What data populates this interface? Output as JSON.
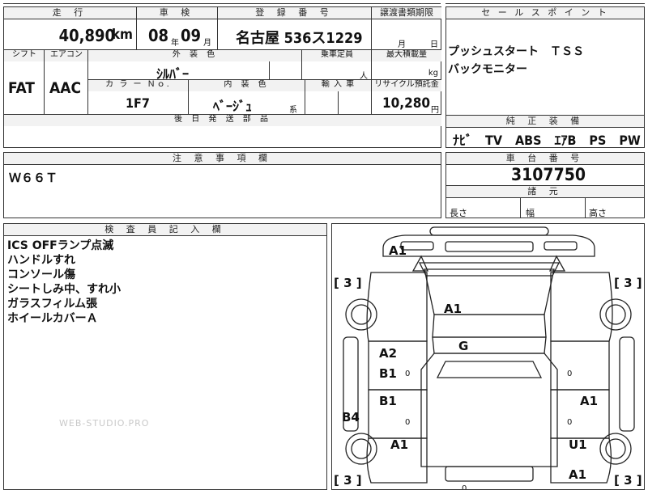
{
  "top_main": {
    "headers": {
      "mileage": "走 行",
      "inspection": "車 検",
      "registration": "登 録 番 号",
      "transfer_deadline": "譲渡書類期限"
    },
    "mileage_value": "40,890",
    "mileage_unit": "km",
    "inspection_year": "08",
    "inspection_year_unit": "年",
    "inspection_month": "09",
    "inspection_month_unit": "月",
    "registration_value": "名古屋 536ス1229",
    "transfer_month_unit": "月",
    "transfer_day_unit": "日",
    "shift_header": "シフト",
    "aircon_header": "エアコン",
    "exterior_color_header": "外 装 色",
    "capacity_header": "乗車定員",
    "max_load_header": "最大積載量",
    "shift_value": "FAT",
    "aircon_value": "AAC",
    "exterior_color_value": "ｼﾙﾊﾞｰ",
    "capacity_unit": "人",
    "max_load_unit": "kg",
    "color_no_header": "カ ラ ー Ｎｏ.",
    "interior_color_header": "内 装 色",
    "import_header": "輸 入 車",
    "recycle_header": "リサイクル預託金",
    "color_no_value": "1F7",
    "interior_color_value": "ﾍﾞｰｼﾞｭ",
    "interior_color_suffix": "系",
    "recycle_value": "10,280",
    "recycle_unit": "円",
    "later_parts_header": "後 日 発 送 部 品"
  },
  "sales_point": {
    "header": "セ ー ル ス ポ イ ン ト",
    "lines": [
      "プッシュスタート　ＴＳＳ",
      "バックモニター"
    ]
  },
  "genuine_equipment": {
    "header": "純 正 装 備",
    "value": "ﾅﾋﾞ　TV　ABS　ｴｱB　PS　PW"
  },
  "caution": {
    "header": "注 意 事 項 欄",
    "value": "Ｗ６６Ｔ"
  },
  "chassis": {
    "header": "車 台 番 号",
    "value": "3107750"
  },
  "specs": {
    "header": "諸 元",
    "length_label": "長さ",
    "width_label": "幅",
    "height_label": "高さ"
  },
  "inspector": {
    "header": "検 査 員 記 入 欄",
    "lines": [
      "ICS OFFランプ点滅",
      "ハンドルすれ",
      "コンソール傷",
      "シートしみ中、すれ小",
      "ガラスフィルム張",
      "ホイールカバーＡ"
    ]
  },
  "watermark": "WEB-STUDIO.PRO",
  "diagram": {
    "marks": [
      "A1",
      "A1",
      "G",
      "A2",
      "B1",
      "B1",
      "B4",
      "A1",
      "A1",
      "A1",
      "U1",
      "A1"
    ],
    "bracket_marks": [
      "[ 3 ]",
      "[ 3 ]",
      "[ 3 ]",
      "[ 3 ]"
    ],
    "zero_marks": [
      "0",
      "0",
      "0",
      "0",
      "0"
    ]
  }
}
